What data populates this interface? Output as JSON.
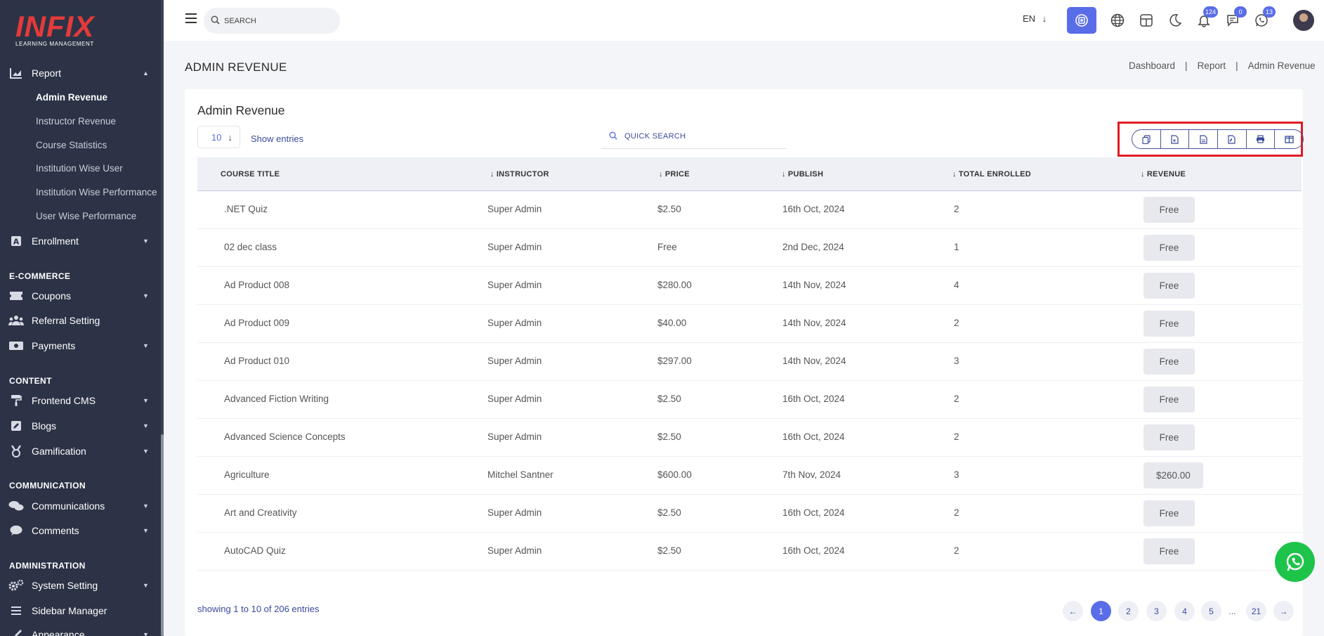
{
  "logo": {
    "brand": "INFIX",
    "tagline": "LEARNING MANAGEMENT"
  },
  "sidebar": {
    "report": {
      "label": "Report",
      "sub": [
        "Admin Revenue",
        "Instructor Revenue",
        "Course Statistics",
        "Institution Wise User",
        "Institution Wise Performance",
        "User Wise Performance"
      ]
    },
    "enrollment": "Enrollment",
    "sections": {
      "ecommerce": "E-COMMERCE",
      "content": "CONTENT",
      "communication": "COMMUNICATION",
      "administration": "ADMINISTRATION"
    },
    "coupons": "Coupons",
    "referral": "Referral Setting",
    "payments": "Payments",
    "frontend": "Frontend CMS",
    "blogs": "Blogs",
    "gamification": "Gamification",
    "communications": "Communications",
    "comments": "Comments",
    "system": "System Setting",
    "sidebar_manager": "Sidebar Manager",
    "appearance": "Appearance"
  },
  "header": {
    "search_placeholder": "SEARCH",
    "lang": "EN",
    "badges": {
      "notifications": "124",
      "messages": "0",
      "whatsapp": "13"
    }
  },
  "page": {
    "title": "ADMIN REVENUE",
    "breadcrumb": [
      "Dashboard",
      "Report",
      "Admin Revenue"
    ]
  },
  "card": {
    "title": "Admin Revenue",
    "entries_value": "10",
    "entries_label": "Show entries",
    "quick_search_placeholder": "QUICK SEARCH"
  },
  "table": {
    "columns": [
      "COURSE TITLE",
      "INSTRUCTOR",
      "PRICE",
      "PUBLISH",
      "TOTAL ENROLLED",
      "REVENUE"
    ],
    "rows": [
      {
        "title": ".NET Quiz",
        "instructor": "Super Admin",
        "price": "$2.50",
        "publish": "16th Oct, 2024",
        "enrolled": "2",
        "revenue": "Free"
      },
      {
        "title": "02 dec class",
        "instructor": "Super Admin",
        "price": "Free",
        "publish": "2nd Dec, 2024",
        "enrolled": "1",
        "revenue": "Free"
      },
      {
        "title": "Ad Product 008",
        "instructor": "Super Admin",
        "price": "$280.00",
        "publish": "14th Nov, 2024",
        "enrolled": "4",
        "revenue": "Free"
      },
      {
        "title": "Ad Product 009",
        "instructor": "Super Admin",
        "price": "$40.00",
        "publish": "14th Nov, 2024",
        "enrolled": "2",
        "revenue": "Free"
      },
      {
        "title": "Ad Product 010",
        "instructor": "Super Admin",
        "price": "$297.00",
        "publish": "14th Nov, 2024",
        "enrolled": "3",
        "revenue": "Free"
      },
      {
        "title": "Advanced Fiction Writing",
        "instructor": "Super Admin",
        "price": "$2.50",
        "publish": "16th Oct, 2024",
        "enrolled": "2",
        "revenue": "Free"
      },
      {
        "title": "Advanced Science Concepts",
        "instructor": "Super Admin",
        "price": "$2.50",
        "publish": "16th Oct, 2024",
        "enrolled": "2",
        "revenue": "Free"
      },
      {
        "title": "Agriculture",
        "instructor": "Mitchel Santner",
        "price": "$600.00",
        "publish": "7th Nov, 2024",
        "enrolled": "3",
        "revenue": "$260.00"
      },
      {
        "title": "Art and Creativity",
        "instructor": "Super Admin",
        "price": "$2.50",
        "publish": "16th Oct, 2024",
        "enrolled": "2",
        "revenue": "Free"
      },
      {
        "title": "AutoCAD Quiz",
        "instructor": "Super Admin",
        "price": "$2.50",
        "publish": "16th Oct, 2024",
        "enrolled": "2",
        "revenue": "Free"
      }
    ]
  },
  "footer": {
    "showing": "showing 1 to 10 of 206 entries",
    "pages": [
      "1",
      "2",
      "3",
      "4",
      "5",
      "...",
      "21"
    ]
  }
}
